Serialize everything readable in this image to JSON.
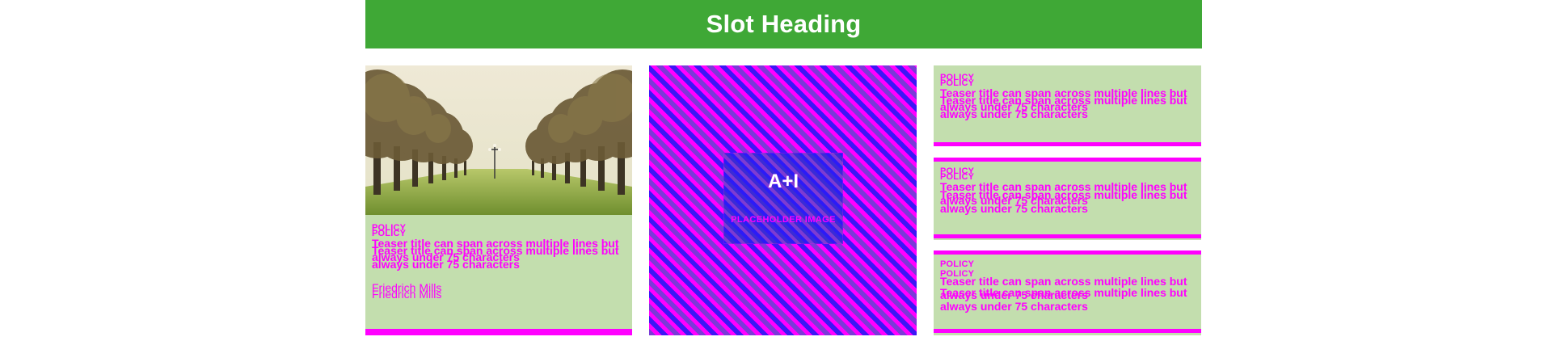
{
  "slot": {
    "heading": "Slot Heading"
  },
  "colors": {
    "header_bg": "#3fa836",
    "card_bg": "#c3deae",
    "accent_magenta": "#ff00ff"
  },
  "column1": {
    "image_alt": "Palm tree avenue with a street lamp",
    "kicker_1": "POLICY",
    "kicker_2": "POLICY",
    "teaser_1": "Teaser title can span across multiple lines but always under 75 characters",
    "teaser_2": "Teaser title can span across multiple lines but always under 75 characters",
    "author_1": "Friedrich Mills",
    "author_2": "Friedrich Mills"
  },
  "column2": {
    "placeholder_symbol": "A+I",
    "placeholder_text": "PLACEHOLDER IMAGE"
  },
  "column3": {
    "items": [
      {
        "kicker_1": "POLICY",
        "kicker_2": "POLICY",
        "teaser_1": "Teaser title can span across multiple lines but always under 75 characters",
        "teaser_2": "Teaser title can span across multiple lines but always under 75 characters"
      },
      {
        "kicker_1": "POLICY",
        "kicker_2": "POLICY",
        "teaser_1": "Teaser title can span across multiple lines but always under 75 characters",
        "teaser_2": "Teaser title can span across multiple lines but always under 75 characters"
      },
      {
        "kicker_1": "POLICY",
        "kicker_2": "POLICY",
        "teaser_1": "Teaser title can span across multiple lines but always under 75 characters",
        "teaser_2": "Teaser title can span across multiple lines but always under 75 characters"
      }
    ]
  }
}
